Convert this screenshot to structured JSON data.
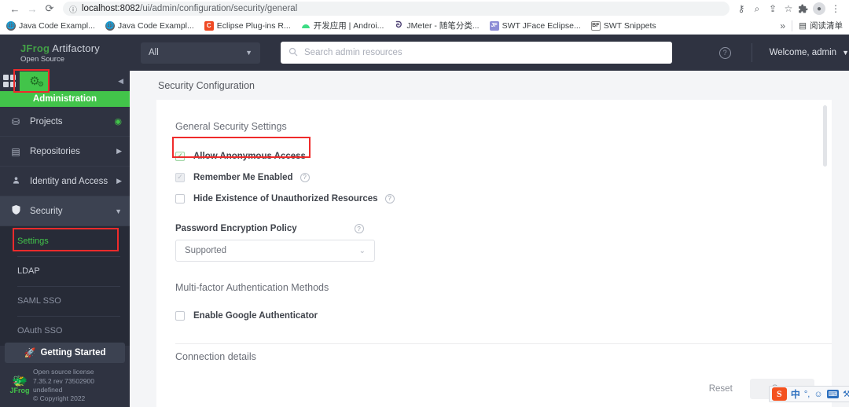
{
  "browser": {
    "nav": {
      "back": "←",
      "forward": "→",
      "reload": "⟳"
    },
    "omnibox": {
      "info_icon": "ⓘ",
      "host": "localhost:8082",
      "path": "/ui/admin/configuration/security/general",
      "key_icon": "⚷",
      "search_icon": "⌕",
      "share_icon": "⇪",
      "star_icon": "☆"
    },
    "actions": {
      "extensions_icon": "🧩",
      "profile_icon": "●",
      "menu_icon": "⋮"
    },
    "bookmarks": [
      {
        "label": "Java Code Exampl...",
        "icon": "globe"
      },
      {
        "label": "Java Code Exampl...",
        "icon": "globe"
      },
      {
        "label": "Eclipse Plug-ins R...",
        "icon": "eclipse",
        "glyph": "C"
      },
      {
        "label": "开发应用 | Androi...",
        "icon": "android",
        "glyph": "▲"
      },
      {
        "label": "JMeter - 随笔分类...",
        "icon": "jmeter",
        "glyph": "ᘐ"
      },
      {
        "label": "SWT JFace Eclipse...",
        "icon": "swt",
        "glyph": "JF"
      },
      {
        "label": "SWT Snippets",
        "icon": "snip",
        "glyph": "BF"
      }
    ],
    "overflow_label": "»",
    "reading_list": {
      "icon": "▤",
      "label": "阅读清单"
    }
  },
  "sidebar": {
    "brand": {
      "jfrog": "JFrog",
      "product": "Artifactory",
      "edition": "Open Source"
    },
    "module": {
      "apps_grid_icon": "apps-grid-icon",
      "admin_icon": "⚙",
      "admin_icon_small": "⚙",
      "collapse_icon": "◀",
      "label": "Administration"
    },
    "items": [
      {
        "label": "Projects",
        "icon": "⛁",
        "right": "◉",
        "right_kind": "dot"
      },
      {
        "label": "Repositories",
        "icon": "▤",
        "right": "▶",
        "right_kind": "arrow"
      },
      {
        "label": "Identity and Access",
        "icon": "👤",
        "right": "▶",
        "right_kind": "arrow"
      },
      {
        "label": "Security",
        "icon": "🛡",
        "right": "▼",
        "right_kind": "arrow",
        "active": true
      }
    ],
    "sub_items": [
      {
        "label": "Settings",
        "state": "selected"
      },
      {
        "label": "LDAP",
        "state": "normal"
      },
      {
        "label": "SAML SSO",
        "state": "dim"
      },
      {
        "label": "OAuth SSO",
        "state": "dim"
      }
    ],
    "getting_started": {
      "icon": "🚀",
      "label": "Getting Started"
    },
    "footer": {
      "logo_text": "JFrog",
      "license": "Open source license",
      "version": "7.35.2 rev 73502900",
      "undefined": "undefined",
      "copyright": "© Copyright 2022"
    }
  },
  "topbar": {
    "scope": {
      "value": "All",
      "caret": "▼"
    },
    "search": {
      "placeholder": "Search admin resources",
      "icon": "⌕"
    },
    "help_icon": "?",
    "welcome": {
      "label": "Welcome, admin",
      "caret": "▼"
    }
  },
  "page": {
    "title": "Security Configuration",
    "general": {
      "section_title": "General Security Settings",
      "checkboxes": [
        {
          "label": "Allow Anonymous Access",
          "checked": true,
          "state": "checked-green",
          "mark": "✓",
          "help": false
        },
        {
          "label": "Remember Me Enabled",
          "checked": true,
          "state": "checked-disabled",
          "mark": "✓",
          "help": true
        },
        {
          "label": "Hide Existence of Unauthorized Resources",
          "checked": false,
          "state": "",
          "mark": "",
          "help": true
        }
      ]
    },
    "password_policy": {
      "label": "Password Encryption Policy",
      "help": "?",
      "value": "Supported",
      "caret": "⌄"
    },
    "mfa": {
      "section_title": "Multi-factor Authentication Methods",
      "checkbox": {
        "label": "Enable Google Authenticator",
        "checked": false,
        "mark": ""
      }
    },
    "connection_details_title": "Connection details",
    "footer": {
      "reset_label": "Reset",
      "save_label": "Save"
    }
  },
  "ime": {
    "logo": "S",
    "items": [
      {
        "name": "chinese-mode-icon",
        "glyph": "中",
        "kind": "cn"
      },
      {
        "name": "punctuation-mode-icon",
        "glyph": "°,",
        "kind": "plain"
      },
      {
        "name": "emoji-icon",
        "glyph": "☺",
        "kind": "plain"
      },
      {
        "name": "soft-keyboard-icon",
        "glyph": "⌨",
        "kind": "kbd"
      },
      {
        "name": "toolbox-icon",
        "glyph": "⚒",
        "kind": "plain"
      }
    ]
  },
  "colors": {
    "accent_green": "#42c44a",
    "sidebar_dark": "#2f3341",
    "highlight_red": "#ef2b2b"
  }
}
